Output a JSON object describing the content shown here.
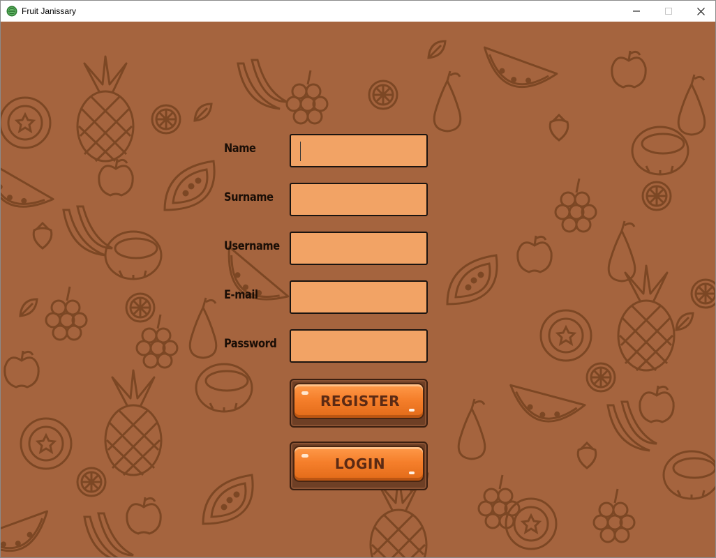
{
  "window": {
    "title": "Fruit Janissary",
    "icon": "watermelon-icon",
    "controls": [
      "minimize-icon",
      "maximize-icon",
      "close-icon"
    ]
  },
  "form": {
    "fields": [
      {
        "label": "Name",
        "value": "",
        "focused": true
      },
      {
        "label": "Surname",
        "value": ""
      },
      {
        "label": "Username",
        "value": ""
      },
      {
        "label": "E-mail",
        "value": ""
      },
      {
        "label": "Password",
        "value": ""
      }
    ],
    "register_label": "REGISTER",
    "login_label": "LOGIN"
  },
  "colors": {
    "background": "#a5643e",
    "pattern_line": "#7c4724",
    "input_fill": "#f2a365",
    "button_orange": "#f57f2b",
    "button_text": "#5b2a14"
  }
}
